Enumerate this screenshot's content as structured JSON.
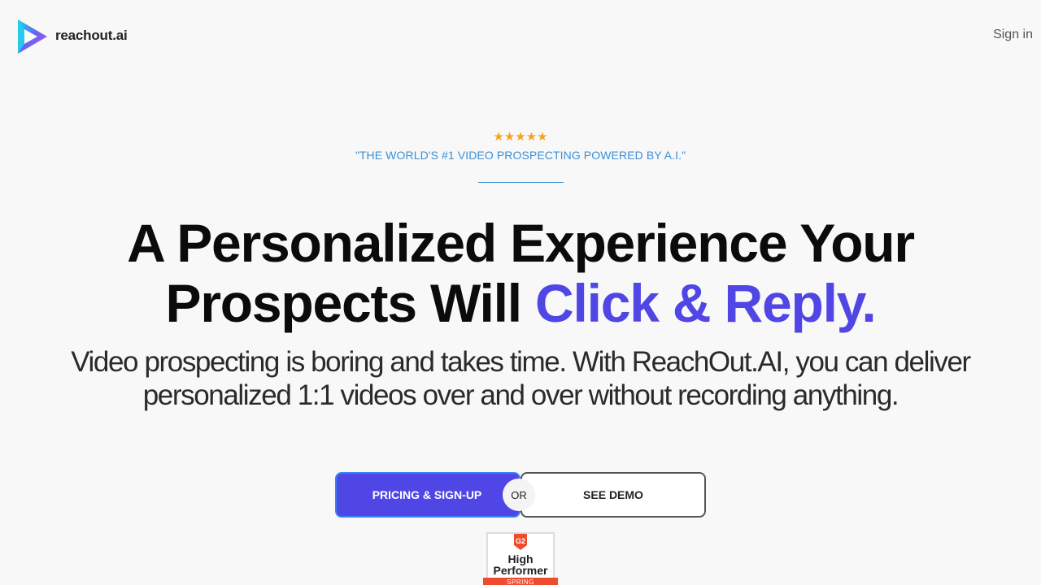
{
  "header": {
    "logo_text": "reachout.ai",
    "signin_label": "Sign in"
  },
  "hero": {
    "stars": "★★★★★",
    "rating_count": 5,
    "tagline": "\"THE WORLD'S #1 VIDEO PROSPECTING POWERED BY A.I.\"",
    "headline_part1": "A Personalized Experience Your Prospects Will ",
    "headline_accent": "Click & Reply.",
    "subhead": "Video prospecting is boring and takes time. With ReachOut.AI, you can deliver personalized 1:1 videos over and over without recording anything."
  },
  "cta": {
    "primary_label": "PRICING & SIGN-UP",
    "or_label": "OR",
    "secondary_label": "SEE DEMO"
  },
  "badge": {
    "title": "High Performer",
    "ribbon": "SPRING"
  },
  "colors": {
    "accent": "#4f46e5",
    "tagline": "#3c8fd6",
    "stars": "#f4a321",
    "g2_red": "#ef4b2f"
  },
  "icons": {
    "logo": "play-triangle-logo-icon",
    "g2": "g2-logo-icon"
  }
}
